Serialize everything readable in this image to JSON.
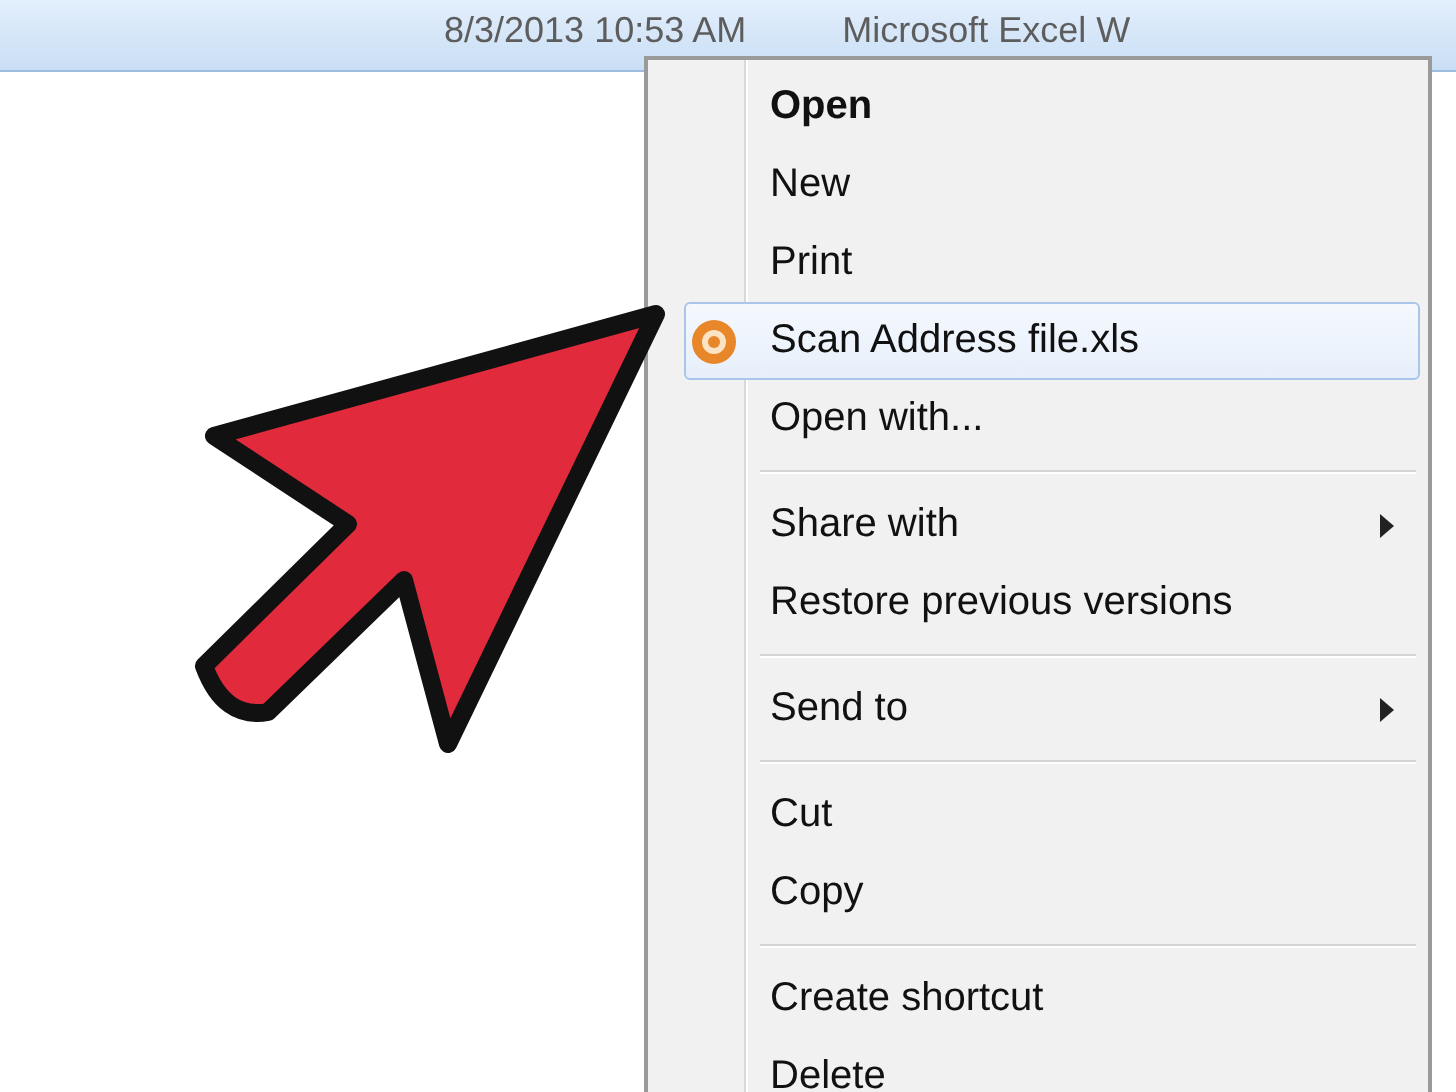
{
  "file_row": {
    "date_modified": "8/3/2013 10:53 AM",
    "type": "Microsoft Excel W"
  },
  "context_menu": [
    {
      "kind": "item",
      "label": "Open",
      "bold": true,
      "submenu": false,
      "has_icon": false,
      "selected": false
    },
    {
      "kind": "item",
      "label": "New",
      "bold": false,
      "submenu": false,
      "has_icon": false,
      "selected": false
    },
    {
      "kind": "item",
      "label": "Print",
      "bold": false,
      "submenu": false,
      "has_icon": false,
      "selected": false
    },
    {
      "kind": "item",
      "label": "Scan Address file.xls",
      "bold": false,
      "submenu": false,
      "has_icon": true,
      "selected": true
    },
    {
      "kind": "item",
      "label": "Open with...",
      "bold": false,
      "submenu": false,
      "has_icon": false,
      "selected": false
    },
    {
      "kind": "separator"
    },
    {
      "kind": "item",
      "label": "Share with",
      "bold": false,
      "submenu": true,
      "has_icon": false,
      "selected": false
    },
    {
      "kind": "item",
      "label": "Restore previous versions",
      "bold": false,
      "submenu": false,
      "has_icon": false,
      "selected": false
    },
    {
      "kind": "separator"
    },
    {
      "kind": "item",
      "label": "Send to",
      "bold": false,
      "submenu": true,
      "has_icon": false,
      "selected": false
    },
    {
      "kind": "separator"
    },
    {
      "kind": "item",
      "label": "Cut",
      "bold": false,
      "submenu": false,
      "has_icon": false,
      "selected": false
    },
    {
      "kind": "item",
      "label": "Copy",
      "bold": false,
      "submenu": false,
      "has_icon": false,
      "selected": false
    },
    {
      "kind": "separator"
    },
    {
      "kind": "item",
      "label": "Create shortcut",
      "bold": false,
      "submenu": false,
      "has_icon": false,
      "selected": false
    },
    {
      "kind": "item",
      "label": "Delete",
      "bold": false,
      "submenu": false,
      "has_icon": false,
      "selected": false
    }
  ]
}
